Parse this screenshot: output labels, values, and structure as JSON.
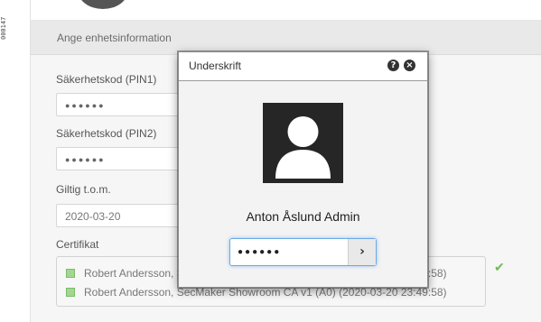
{
  "side_tab": "000147",
  "section": {
    "title": "Ange enhetsinformation"
  },
  "form": {
    "pin1_label": "Säkerhetskod (PIN1)",
    "pin1_value": "●●●●●●",
    "pin2_label": "Säkerhetskod (PIN2)",
    "pin2_value": "●●●●●●",
    "valid_label": "Giltig t.o.m.",
    "valid_value": "2020-03-20",
    "cert_label": "Certifikat",
    "certificates": [
      "Robert Andersson, SecMaker Showroom CA v1 (A0) (2020-03-20 23:49:58)",
      "Robert Andersson, SecMaker Showroom CA v1 (A0) (2020-03-20 23:49:58)"
    ]
  },
  "dialog": {
    "title": "Underskrift",
    "help_icon": "?",
    "close_icon": "×",
    "user_name": "Anton Åslund Admin",
    "pin_value": "●●●●●●",
    "submit_icon": "›"
  },
  "colors": {
    "accent_focus": "#6aa9e6",
    "check_green": "#6dbb55"
  }
}
